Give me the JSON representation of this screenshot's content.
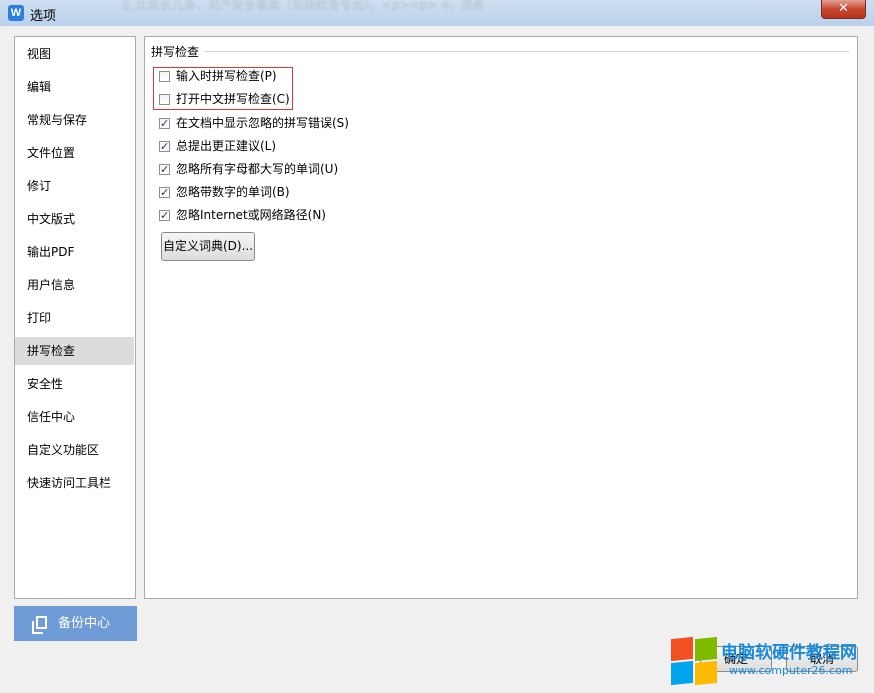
{
  "window": {
    "title": "选项",
    "app_icon": "W",
    "close_glyph": "✕",
    "blurred_title_text": "主,比就长儿身、对产安全事故（包括检查专出）、<p><p>     4、须表"
  },
  "sidebar": {
    "items": [
      {
        "label": "视图",
        "active": false
      },
      {
        "label": "编辑",
        "active": false
      },
      {
        "label": "常规与保存",
        "active": false
      },
      {
        "label": "文件位置",
        "active": false
      },
      {
        "label": "修订",
        "active": false
      },
      {
        "label": "中文版式",
        "active": false
      },
      {
        "label": "输出PDF",
        "active": false
      },
      {
        "label": "用户信息",
        "active": false
      },
      {
        "label": "打印",
        "active": false
      },
      {
        "label": "拼写检查",
        "active": true
      },
      {
        "label": "安全性",
        "active": false
      },
      {
        "label": "信任中心",
        "active": false
      },
      {
        "label": "自定义功能区",
        "active": false
      },
      {
        "label": "快速访问工具栏",
        "active": false
      }
    ]
  },
  "spellcheck": {
    "group_title": "拼写检查",
    "options": [
      {
        "label": "输入时拼写检查(P)",
        "checked": false
      },
      {
        "label": "打开中文拼写检查(C)",
        "checked": false
      },
      {
        "label": "在文档中显示忽略的拼写错误(S)",
        "checked": true
      },
      {
        "label": "总提出更正建议(L)",
        "checked": true
      },
      {
        "label": "忽略所有字母都大写的单词(U)",
        "checked": true
      },
      {
        "label": "忽略带数字的单词(B)",
        "checked": true
      },
      {
        "label": "忽略Internet或网络路径(N)",
        "checked": true
      }
    ],
    "custom_dict_button": "自定义词典(D)..."
  },
  "footer": {
    "backup_label": "备份中心",
    "ok_label": "确定",
    "cancel_label": "取消"
  },
  "watermark": {
    "line1": "电脑软硬件教程网",
    "line2": "www.computer26.com"
  },
  "colors": {
    "highlight": "#d23a3a",
    "backup_bg": "#6f9bd6",
    "selected_nav": "#dcdcdc"
  }
}
